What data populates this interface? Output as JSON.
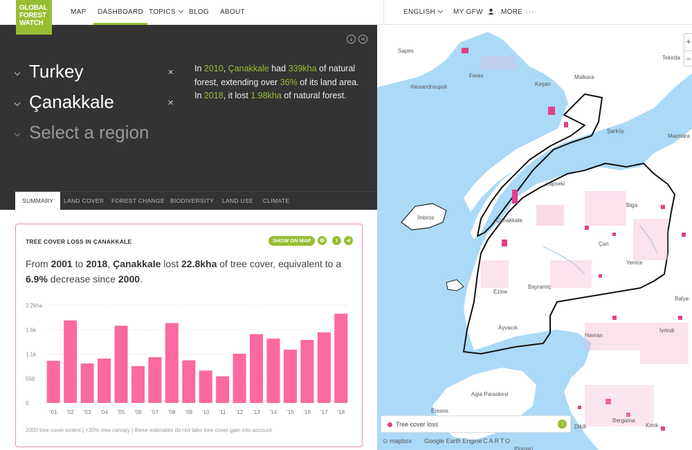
{
  "header": {
    "logo": [
      "GLOBAL",
      "FOREST",
      "WATCH"
    ],
    "nav": [
      "MAP",
      "DASHBOARD",
      "TOPICS",
      "BLOG",
      "ABOUT"
    ],
    "right_nav": [
      "ENGLISH",
      "MY GFW",
      "MORE"
    ],
    "accent": "#97be32"
  },
  "location": {
    "country": "Turkey",
    "region": "Çanakkale",
    "placeholder": "Select a region"
  },
  "summary": {
    "pre1": "In ",
    "year1": "2010",
    "pre2": ", ",
    "region": "Çanakkale",
    "pre3": " had ",
    "extent": "339kha",
    "pre4": " of natural forest, extending over ",
    "percent": "36%",
    "pre5": " of its land area. In ",
    "year2": "2018",
    "pre6": ", it lost ",
    "loss": "1.98kha",
    "pre7": " of natural forest."
  },
  "tabs": [
    "SUMMARY",
    "LAND COVER",
    "FOREST CHANGE",
    "BIODIVERSITY",
    "LAND USE",
    "CLIMATE"
  ],
  "widget": {
    "title": "TREE COVER LOSS IN ÇANAKKALE",
    "show_on_map": "SHOW ON MAP",
    "s1": "From ",
    "start": "2001",
    "s2": " to ",
    "end": "2018",
    "s3": ", ",
    "region": "Çanakkale",
    "s4": " lost ",
    "lost": "22.8kha",
    "s5": " of tree cover, equivalent to a ",
    "pct": "6.9%",
    "s6": " decrease since ",
    "since": "2000",
    "s7": ".",
    "footnote": "2000 tree cover extent | >30% tree canopy | these estimates do not take tree cover gain into account"
  },
  "chart_data": {
    "type": "bar",
    "categories": [
      "'01",
      "'02",
      "'03",
      "'04",
      "'05",
      "'06",
      "'07",
      "'08",
      "'09",
      "'10",
      "'11",
      "'12",
      "'13",
      "'14",
      "'15",
      "'16",
      "'17",
      "'18"
    ],
    "values": [
      950,
      1860,
      890,
      1000,
      1740,
      830,
      1030,
      1800,
      960,
      730,
      600,
      1110,
      1550,
      1450,
      1200,
      1420,
      1590,
      2010
    ],
    "yticks": [
      "0",
      "550",
      "1.1k",
      "1.6k",
      "2.2kha"
    ],
    "ylim": [
      0,
      2200
    ],
    "color": "#fa6aa0"
  },
  "map": {
    "labels": [
      "Sapes",
      "Alexandroupoli",
      "Feres",
      "Keşan",
      "Malkara",
      "Tekirda",
      "Şarköy",
      "Marmara",
      "Lapseki",
      "İmbros",
      "Çanakkale",
      "Biga",
      "Çan",
      "Yenice",
      "Bayramiç",
      "Ezine",
      "Balya",
      "Ayvacık",
      "İvrindi",
      "Havran",
      "Agia Paraskevi",
      "Eresos",
      "Dikili",
      "Bergama",
      "Kınık",
      "Plomari"
    ],
    "legend": "Tree cover loss",
    "attribution": [
      "mapbox",
      "Google Earth Engine",
      "CARTO"
    ],
    "water": "#aadaf8",
    "loss_color": "#e0408a"
  }
}
